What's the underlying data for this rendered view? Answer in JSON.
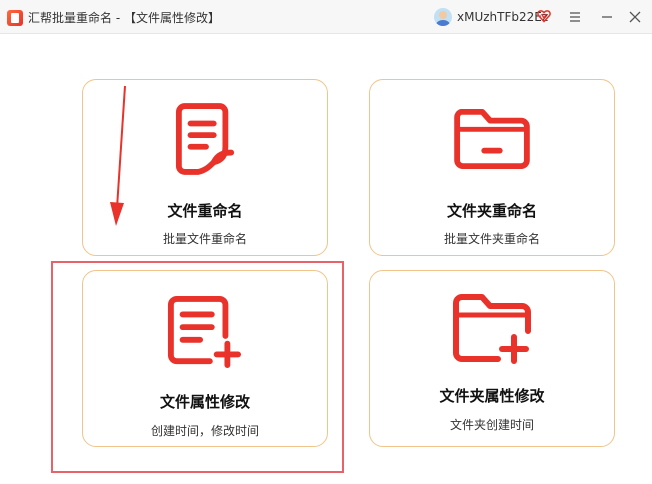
{
  "window": {
    "title": "汇帮批量重命名 - 【文件属性修改】",
    "username": "xMUzhTFb22Ez"
  },
  "icons": {
    "app": "app-logo-icon",
    "vip": "heart-v-icon",
    "menu": "hamburger-icon",
    "minimize": "minimize-icon",
    "close": "close-icon"
  },
  "colors": {
    "accent": "#e8322a",
    "card_border": "#f0c58c",
    "highlight": "#e8626a",
    "titlebar": "#f7f7f7"
  },
  "cards": [
    {
      "title": "文件重命名",
      "subtitle": "批量文件重命名",
      "icon": "file-document-icon"
    },
    {
      "title": "文件夹重命名",
      "subtitle": "批量文件夹重命名",
      "icon": "folder-icon"
    },
    {
      "title": "文件属性修改",
      "subtitle": "创建时间，修改时间",
      "icon": "file-plus-icon"
    },
    {
      "title": "文件夹属性修改",
      "subtitle": "文件夹创建时间",
      "icon": "folder-plus-icon"
    }
  ]
}
